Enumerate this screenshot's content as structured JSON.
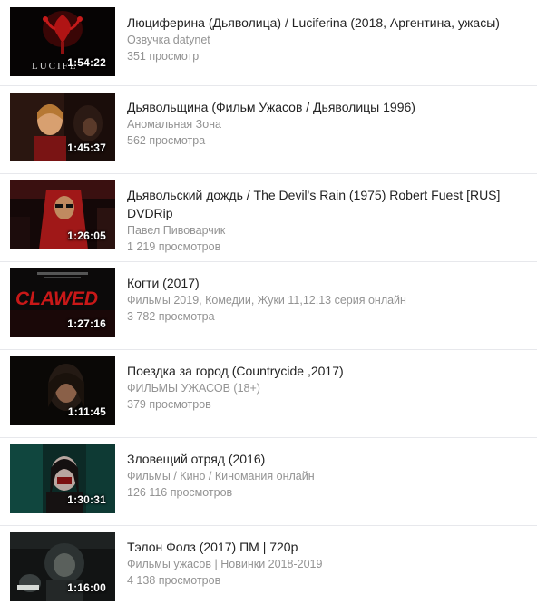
{
  "videos": [
    {
      "title": "Люциферина (Дьяволица) / Luciferina (2018, Аргентина, ужасы)",
      "channel": "Озвучка datynet",
      "views": "351 просмотр",
      "duration": "1:54:22",
      "thumb_text": "LUCIFE"
    },
    {
      "title": "Дьявольщина (Фильм Ужасов / Дьяволицы 1996)",
      "channel": "Аномальная Зона",
      "views": "562 просмотра",
      "duration": "1:45:37"
    },
    {
      "title": "Дьявольский дождь / The Devil's Rain (1975) Robert Fuest [RUS] DVDRip",
      "channel": "Павел Пивоварчик",
      "views": "1 219 просмотров",
      "duration": "1:26:05"
    },
    {
      "title": "Когти (2017)",
      "channel": "Фильмы 2019, Комедии, Жуки 11,12,13 серия онлайн",
      "views": "3 782 просмотра",
      "duration": "1:27:16",
      "thumb_text": "CLAWED"
    },
    {
      "title": "Поездка за город (Countrycide ,2017)",
      "channel": "ФИЛЬМЫ УЖАСОВ (18+)",
      "views": "379 просмотров",
      "duration": "1:11:45"
    },
    {
      "title": "Зловещий отряд (2016)",
      "channel": "Фильмы / Кино / Киномания онлайн",
      "views": "126 116 просмотров",
      "duration": "1:30:31"
    },
    {
      "title": "Тэлон Фолз (2017) ПМ | 720p",
      "channel": "Фильмы ужасов | Новинки 2018-2019",
      "views": "4 138 просмотров",
      "duration": "1:16:00"
    }
  ],
  "colors": {
    "title": "#222222",
    "meta": "#939393",
    "divider": "#e7e8ec"
  }
}
